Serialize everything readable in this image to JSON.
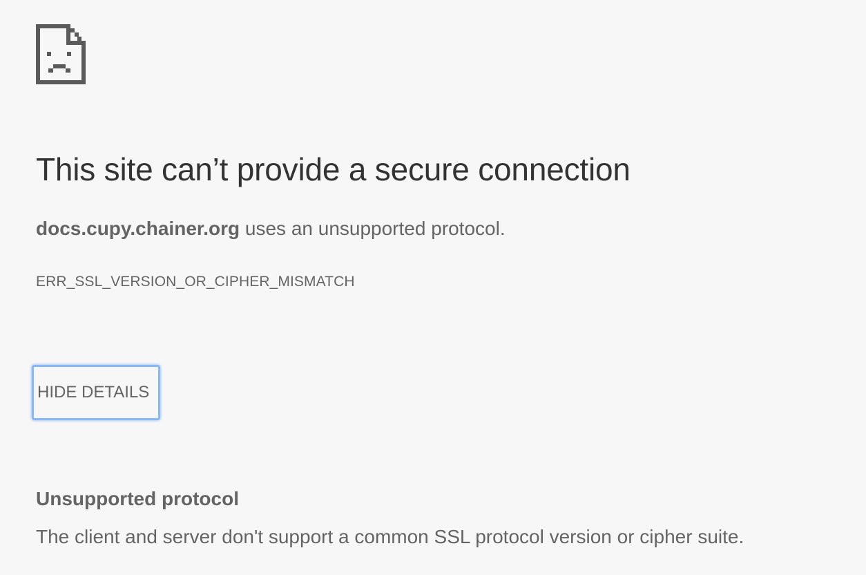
{
  "icon": "sad-page-icon",
  "heading": "This site can’t provide a secure connection",
  "summary": {
    "host": "docs.cupy.chainer.org",
    "message": " uses an unsupported protocol."
  },
  "error_code": "ERR_SSL_VERSION_OR_CIPHER_MISMATCH",
  "details_button": {
    "label": "HIDE DETAILS"
  },
  "details": {
    "heading": "Unsupported protocol",
    "text": "The client and server don't support a common SSL protocol version or cipher suite."
  },
  "colors": {
    "background": "#f7f7f7",
    "heading_text": "#333333",
    "body_text": "#646464",
    "focus_ring": "#86b9f6"
  }
}
